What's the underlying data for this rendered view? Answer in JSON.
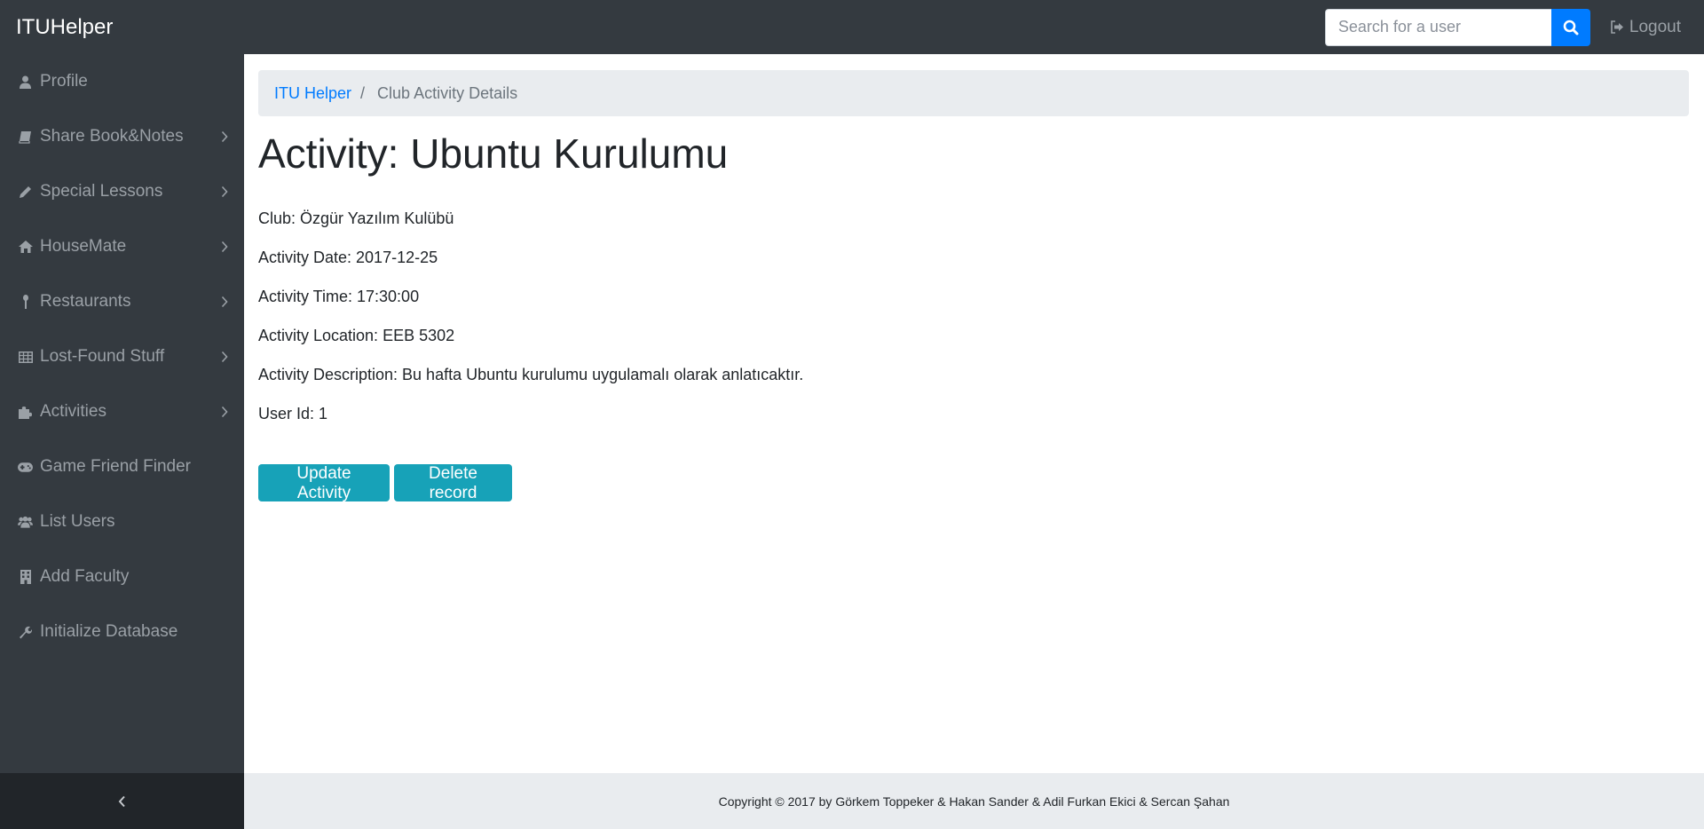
{
  "navbar": {
    "brand": "ITUHelper",
    "search_placeholder": "Search for a user",
    "search_icon": "search-icon",
    "logout_label": "Logout",
    "logout_icon": "sign-out-icon"
  },
  "sidebar": {
    "items": [
      {
        "label": "Profile",
        "icon": "user-icon",
        "has_submenu": false
      },
      {
        "label": "Share Book&Notes",
        "icon": "book-icon",
        "has_submenu": true
      },
      {
        "label": "Special Lessons",
        "icon": "pencil-icon",
        "has_submenu": true
      },
      {
        "label": "HouseMate",
        "icon": "home-icon",
        "has_submenu": true
      },
      {
        "label": "Restaurants",
        "icon": "spoon-icon",
        "has_submenu": true
      },
      {
        "label": "Lost-Found Stuff",
        "icon": "table-icon",
        "has_submenu": true
      },
      {
        "label": "Activities",
        "icon": "puzzle-icon",
        "has_submenu": true
      },
      {
        "label": "Game Friend Finder",
        "icon": "gamepad-icon",
        "has_submenu": false
      },
      {
        "label": "List Users",
        "icon": "users-icon",
        "has_submenu": false
      },
      {
        "label": "Add Faculty",
        "icon": "building-icon",
        "has_submenu": false
      },
      {
        "label": "Initialize Database",
        "icon": "wrench-icon",
        "has_submenu": false
      }
    ],
    "toggle_icon": "chevron-left-icon"
  },
  "breadcrumb": {
    "home": "ITU Helper",
    "separator": "/",
    "current": "Club Activity Details"
  },
  "activity": {
    "title": "Activity: Ubuntu Kurulumu",
    "club": "Club: Özgür Yazılım Kulübü",
    "date": "Activity Date: 2017-12-25",
    "time": "Activity Time: 17:30:00",
    "location": "Activity Location: EEB 5302",
    "description": "Activity Description: Bu hafta Ubuntu kurulumu uygulamalı olarak anlatıcaktır.",
    "user_id": "User Id: 1"
  },
  "actions": {
    "update_label": "Update Activity",
    "delete_label": "Delete record"
  },
  "footer": {
    "copyright": "Copyright © 2017 by Görkem Toppeker & Hakan Sander & Adil Furkan Ekici & Sercan Şahan"
  },
  "colors": {
    "navbar_bg": "#343a40",
    "primary": "#007bff",
    "info_button": "#17a2b8",
    "light_bg": "#e9ecef"
  }
}
